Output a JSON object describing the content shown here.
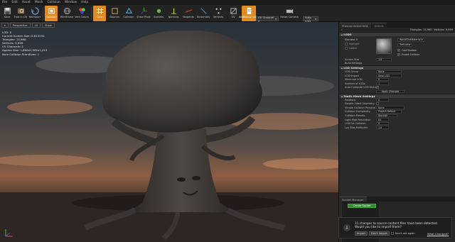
{
  "menu": [
    "File",
    "Edit",
    "Asset",
    "Mesh",
    "Collision",
    "Window",
    "Help"
  ],
  "toolbar": {
    "buttons": [
      {
        "label": "Save",
        "icon": "save-icon"
      },
      {
        "label": "Find in CB",
        "icon": "search-icon"
      },
      {
        "label": "Reimport",
        "icon": "reimport-icon"
      },
      {
        "label": "Collision",
        "icon": "collision-icon"
      },
      {
        "label": "Wireframe",
        "icon": "wireframe-icon"
      },
      {
        "label": "Vert Colors",
        "icon": "vertex-colors-icon"
      },
      {
        "label": "Grid",
        "icon": "grid-icon"
      },
      {
        "label": "Bounds",
        "icon": "bounds-icon"
      },
      {
        "label": "Collision",
        "icon": "collision-view-icon"
      },
      {
        "label": "Show Pivot",
        "icon": "pivot-icon"
      },
      {
        "label": "Sockets",
        "icon": "sockets-icon"
      },
      {
        "label": "Normals",
        "icon": "normals-icon"
      },
      {
        "label": "Tangents",
        "icon": "tangents-icon"
      },
      {
        "label": "Binormals",
        "icon": "binormals-icon"
      },
      {
        "label": "Vertices",
        "icon": "vertices-icon"
      },
      {
        "label": "UV",
        "icon": "uv-icon"
      },
      {
        "label": "Additional Data",
        "icon": "additional-data-icon"
      },
      {
        "label": "Reset Camera",
        "icon": "camera-icon"
      }
    ],
    "uv_channel": "UV Channel 0",
    "lod_select": "Auto LOD"
  },
  "viewport": {
    "view_mode": "Perspective",
    "lit_mode": "Lit",
    "show_btn": "Show",
    "stats": [
      "LOD:  0",
      "Current Screen Size:  0.613254",
      "Triangles:  15,980",
      "Vertices:  9,999",
      "UV Channels:  2",
      "Approx Size: 1,600x1,582x1,415",
      "Num Collision Primitives:  1"
    ]
  },
  "panel": {
    "tab_details": "Preview Scene Sett",
    "tab_other": "Details",
    "triangles": "Triangles: 15,980",
    "vertices": "Vertices: 9,999",
    "lod_section": "LOD0",
    "element0_label": "Element 0",
    "highlight_label": "Highlight",
    "isolate_label": "Isolate",
    "material_name": "WorldGridMaterial",
    "textures_btn": "Textures",
    "cast_shadow": "Cast Shadow",
    "enable_collision": "Enable Collision",
    "screen_size_label": "Screen Size",
    "screen_size_val": "1.0",
    "build_settings": "Build Settings",
    "lod_settings_section": "LOD Settings",
    "lod_group_label": "LOD Group",
    "lod_group_val": "None",
    "lod_import_label": "LOD Import",
    "lod_import_val": "Base LOD",
    "minimum_lod_label": "Minimum LOD",
    "minimum_lod_val": "0",
    "num_lods_label": "Number of LODs",
    "num_lods_val": "1",
    "auto_compute_label": "Auto Compute LOD Distance",
    "apply_changes": "Apply Changes",
    "static_mesh_section": "Static Mesh Settings",
    "positions_label": "Positions",
    "positions_val": "0",
    "double_sided_label": "Double Sided Geometry",
    "simple_collision_label": "Simple Collision Physical M",
    "simple_collision_val": "None",
    "collision_complexity_label": "Collision Complexity",
    "collision_complexity_val": "Project Default",
    "collision_presets_label": "Collision Presets",
    "collision_presets_val": "BlockAll",
    "light_map_res_label": "Light Map Resolution",
    "light_map_res_val": "64",
    "lod_for_collision_label": "LOD For Collision",
    "lod_for_collision_val": "0",
    "lpv_bias_label": "Lpv Bias Multiplier",
    "lpv_bias_val": "1.0",
    "socket_tab": "Socket Manager",
    "create_socket": "Create Socket",
    "select_socket": "Select a Socket"
  },
  "notification": {
    "text": "11 changes to source content files have been detected. Would you like to import them?",
    "import_btn": "Import",
    "dont_import_btn": "Don't Import",
    "dont_ask": "Don't ask again",
    "what_changed": "What Changed?"
  },
  "colors": {
    "accent": "#e28a22",
    "create_socket": "#2e8b2e"
  }
}
